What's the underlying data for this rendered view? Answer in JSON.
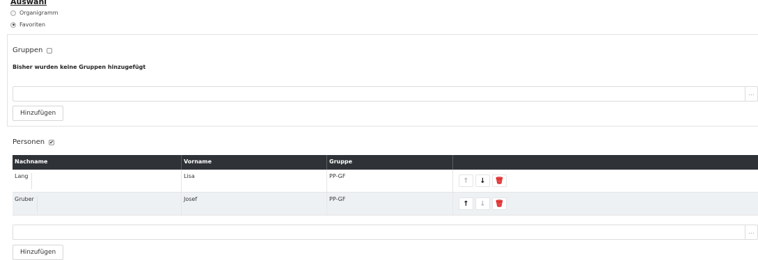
{
  "selection": {
    "heading": "Auswahl",
    "options": [
      {
        "label": "Organigramm",
        "checked": false
      },
      {
        "label": "Favoriten",
        "checked": true
      }
    ]
  },
  "groups": {
    "label": "Gruppen",
    "checked": false,
    "empty_message": "Bisher wurden keine Gruppen hinzugefügt",
    "picker_more": "...",
    "add_label": "Hinzufügen"
  },
  "persons": {
    "label": "Personen",
    "checked": true,
    "columns": [
      "Nachname",
      "Vorname",
      "Gruppe",
      ""
    ],
    "rows": [
      {
        "nachname": "Lang",
        "vorname": "Lisa",
        "gruppe": "PP-GF",
        "up_enabled": false,
        "down_enabled": true
      },
      {
        "nachname": "Gruber",
        "vorname": "Josef",
        "gruppe": "PP-GF",
        "up_enabled": true,
        "down_enabled": false
      }
    ],
    "picker_more": "...",
    "add_label": "Hinzufügen"
  },
  "icons": {
    "up": "arrow-up-icon",
    "down": "arrow-down-icon",
    "delete": "trash-icon"
  },
  "colors": {
    "header_bg": "#2f3338",
    "alt_row_bg": "#eef1f4",
    "delete": "#e02020"
  }
}
